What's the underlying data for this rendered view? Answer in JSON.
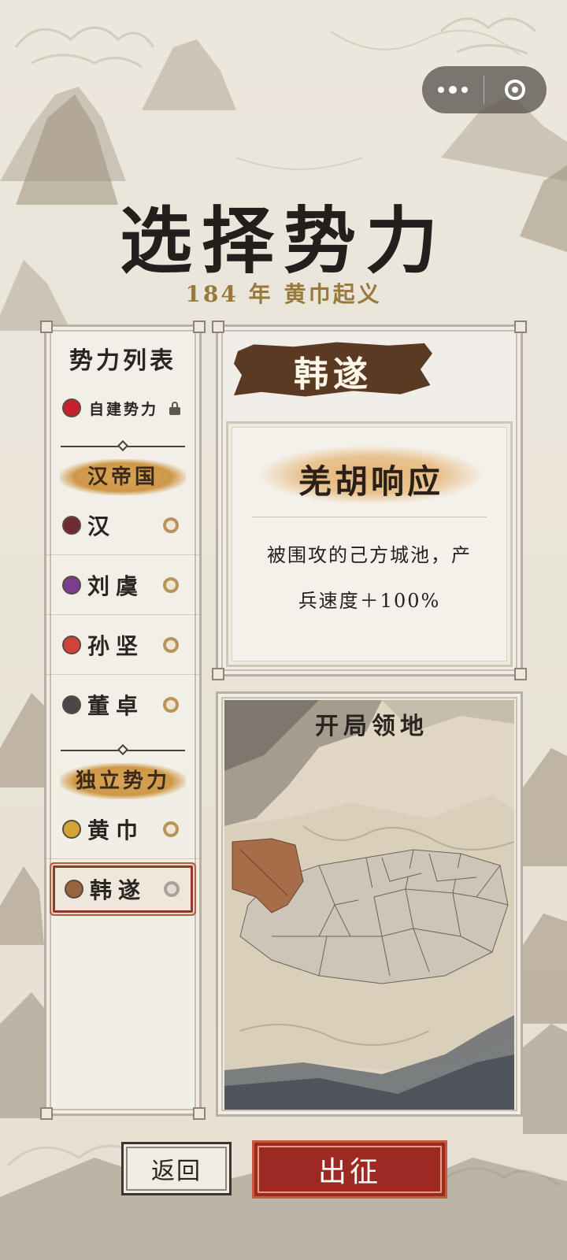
{
  "screen": {
    "title": "选择势力",
    "subtitle_year": "184 年",
    "subtitle_event": "黄巾起义"
  },
  "faction_list": {
    "heading": "势力列表",
    "custom": {
      "label": "自建势力",
      "color": "#c8202c",
      "locked": true
    },
    "groups": [
      {
        "label": "汉帝国",
        "items": [
          {
            "name": "汉",
            "color": "#6f2a33"
          },
          {
            "name": "刘虞",
            "color": "#7b3d8c"
          },
          {
            "name": "孙坚",
            "color": "#d2413a"
          },
          {
            "name": "董卓",
            "color": "#48484c"
          }
        ]
      },
      {
        "label": "独立势力",
        "items": [
          {
            "name": "黄巾",
            "color": "#d4a534"
          },
          {
            "name": "韩遂",
            "color": "#9a6440",
            "selected": true
          }
        ]
      }
    ]
  },
  "selected_faction": {
    "name": "韩遂",
    "trait_name": "羌胡响应",
    "trait_desc_line1": "被围攻的己方城池，产",
    "trait_desc_line2": "兵速度＋100%"
  },
  "map": {
    "title": "开局领地",
    "territory_color": "#a66d48"
  },
  "buttons": {
    "back": "返回",
    "go": "出征"
  },
  "colors": {
    "accent_red": "#9c2a22",
    "banner_brown": "#5b3a24",
    "gold_text": "#9a7a3c"
  }
}
